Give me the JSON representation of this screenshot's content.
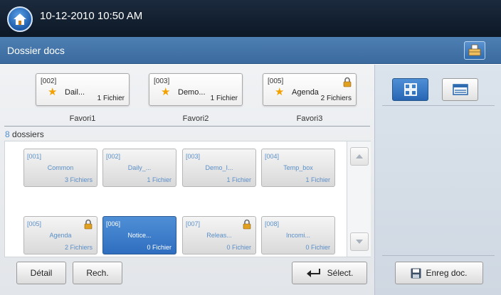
{
  "header": {
    "datetime": "10-12-2010 10:50 AM",
    "home_icon": "home-icon"
  },
  "titlebar": {
    "title": "Dossier docs",
    "tray_icon": "paper-tray-icon"
  },
  "favorites": [
    {
      "code": "[002]",
      "name": "Dail...",
      "count": "1 Fichier",
      "label": "Favori1",
      "locked": false
    },
    {
      "code": "[003]",
      "name": "Demo...",
      "count": "1 Fichier",
      "label": "Favori2",
      "locked": false
    },
    {
      "code": "[005]",
      "name": "Agenda",
      "count": "2 Fichiers",
      "label": "Favori3",
      "locked": true
    }
  ],
  "dossier_count": {
    "number": "8",
    "label": " dossiers"
  },
  "folders": [
    {
      "code": "[001]",
      "name": "Common",
      "count": "3 Fichiers",
      "locked": false,
      "selected": false
    },
    {
      "code": "[002]",
      "name": "Daily_...",
      "count": "1 Fichier",
      "locked": false,
      "selected": false
    },
    {
      "code": "[003]",
      "name": "Demo_I...",
      "count": "1 Fichier",
      "locked": false,
      "selected": false
    },
    {
      "code": "[004]",
      "name": "Temp_box",
      "count": "1 Fichier",
      "locked": false,
      "selected": false
    },
    {
      "code": "[005]",
      "name": "Agenda",
      "count": "2 Fichiers",
      "locked": true,
      "selected": false
    },
    {
      "code": "[006]",
      "name": "Notice...",
      "count": "0 Fichier",
      "locked": false,
      "selected": true
    },
    {
      "code": "[007]",
      "name": "Releas...",
      "count": "0 Fichier",
      "locked": true,
      "selected": false
    },
    {
      "code": "[008]",
      "name": "Incomi...",
      "count": "0 Fichier",
      "locked": false,
      "selected": false
    }
  ],
  "buttons": {
    "detail": "Détail",
    "search": "Rech.",
    "select": "Sélect.",
    "save_doc": "Enreg doc."
  },
  "colors": {
    "accent": "#2f6ebf",
    "count_number": "#4f90cf",
    "folder_text": "#5a8fc8",
    "lock": "#e0a020"
  }
}
